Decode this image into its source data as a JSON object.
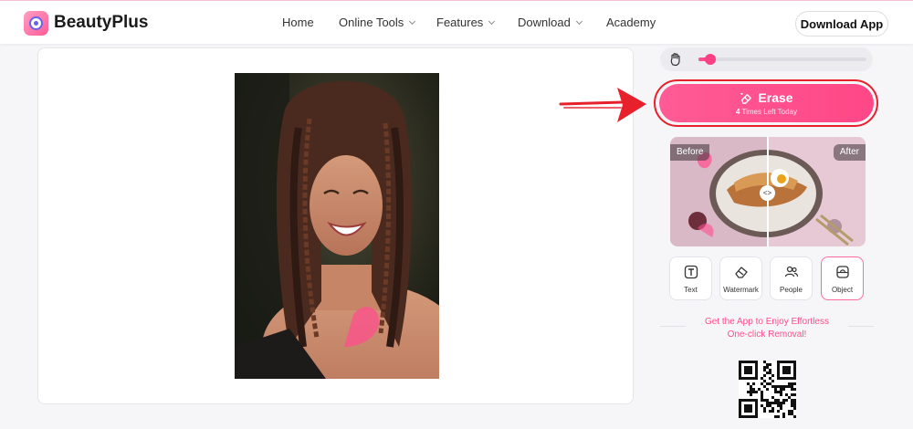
{
  "header": {
    "brand": "BeautyPlus",
    "nav": [
      {
        "label": "Home",
        "has_dropdown": false
      },
      {
        "label": "Online Tools",
        "has_dropdown": true
      },
      {
        "label": "Features",
        "has_dropdown": true
      },
      {
        "label": "Download",
        "has_dropdown": true
      },
      {
        "label": "Academy",
        "has_dropdown": false
      }
    ],
    "download_button": "Download App"
  },
  "brush": {
    "icon": "brush-hand-icon",
    "size_level": 0.04
  },
  "erase": {
    "label": "Erase",
    "count": "4",
    "remaining_text": " Times Left Today",
    "icon": "eraser-sparkle-icon"
  },
  "preview": {
    "before_label": "Before",
    "after_label": "After",
    "divider_icon": "<>"
  },
  "tools": [
    {
      "label": "Text",
      "icon": "text-icon",
      "active": false
    },
    {
      "label": "Watermark",
      "icon": "eraser-icon",
      "active": false
    },
    {
      "label": "People",
      "icon": "people-icon",
      "active": false
    },
    {
      "label": "Object",
      "icon": "object-icon",
      "active": true
    }
  ],
  "promo": {
    "line1": "Get the App to Enjoy Effortless",
    "line2": "One-click Removal!"
  },
  "colors": {
    "accent": "#ff4d8d",
    "annotation_red": "#e8202c"
  }
}
